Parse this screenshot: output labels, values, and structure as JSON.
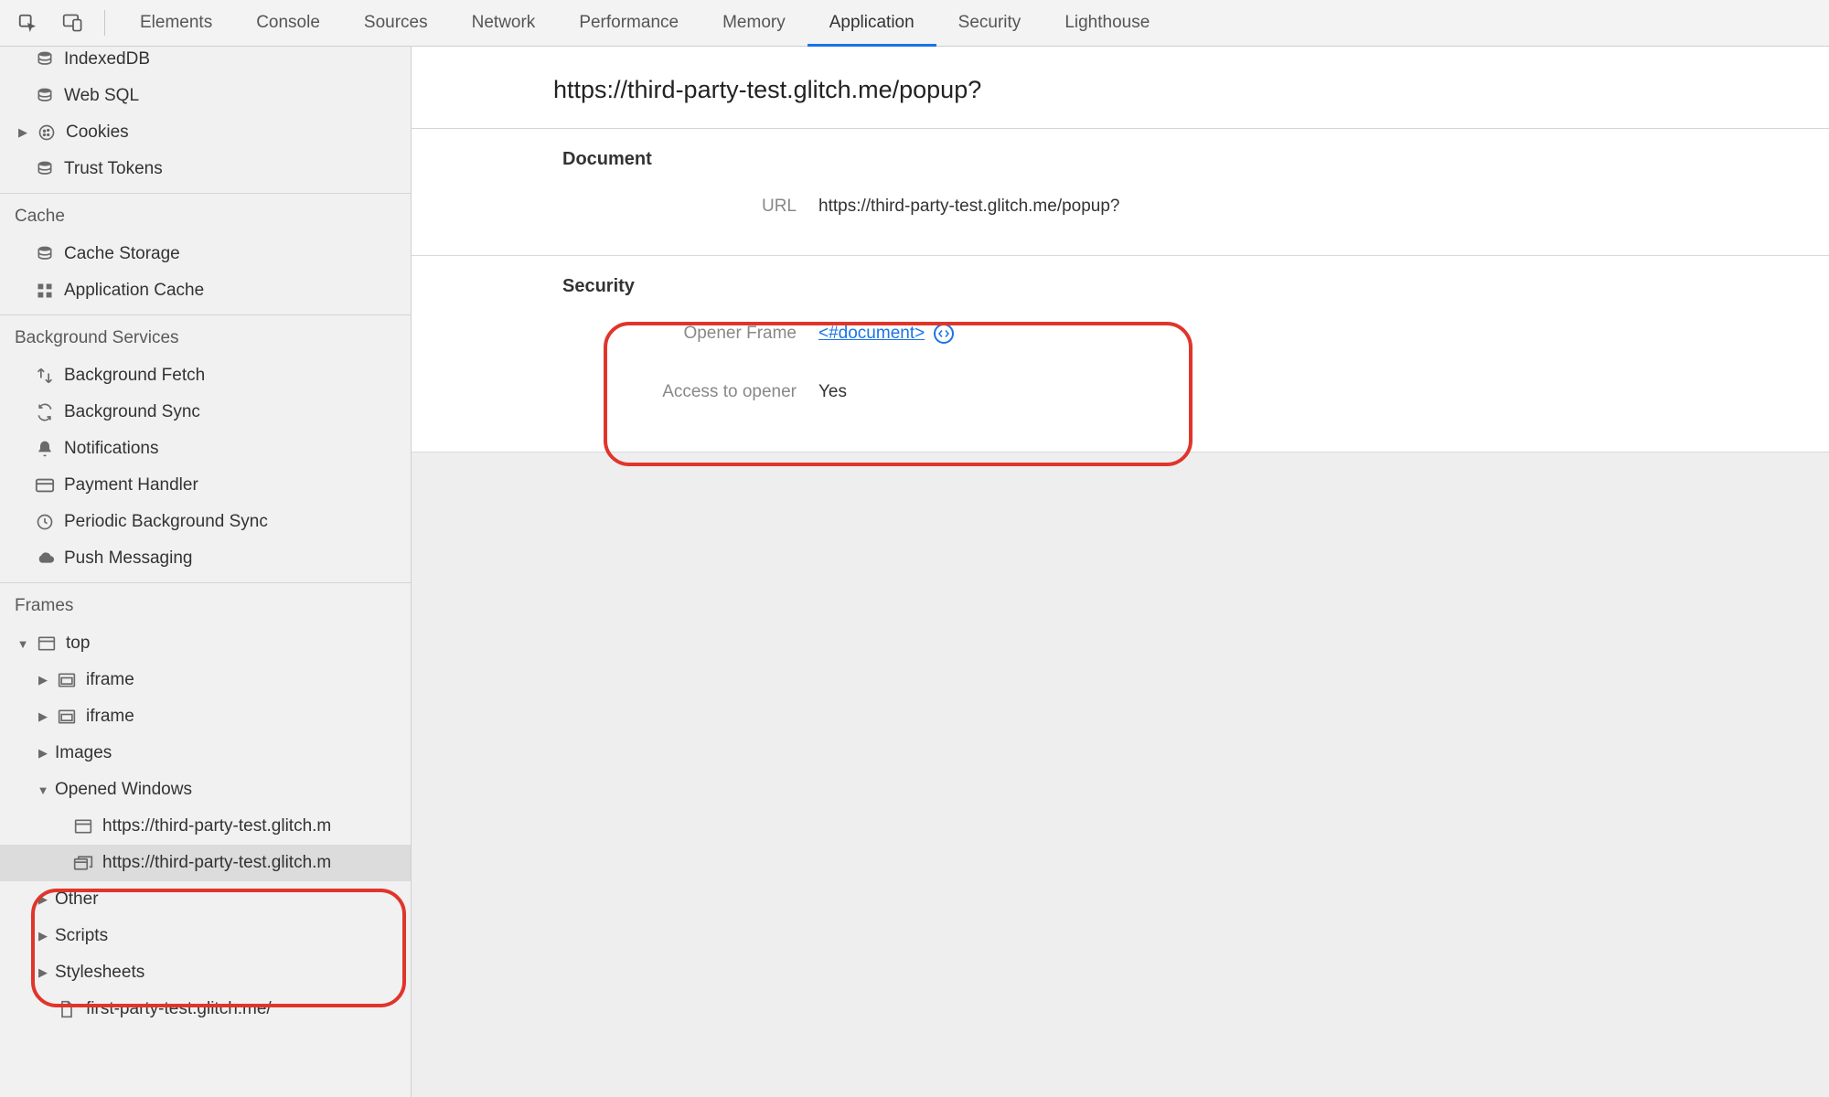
{
  "toolbar": {
    "tabs": [
      "Elements",
      "Console",
      "Sources",
      "Network",
      "Performance",
      "Memory",
      "Application",
      "Security",
      "Lighthouse"
    ],
    "activeTab": "Application"
  },
  "sidebar": {
    "storage": {
      "items": [
        "IndexedDB",
        "Web SQL",
        "Cookies",
        "Trust Tokens"
      ]
    },
    "cache": {
      "title": "Cache",
      "items": [
        "Cache Storage",
        "Application Cache"
      ]
    },
    "backgroundServices": {
      "title": "Background Services",
      "items": [
        "Background Fetch",
        "Background Sync",
        "Notifications",
        "Payment Handler",
        "Periodic Background Sync",
        "Push Messaging"
      ]
    },
    "frames": {
      "title": "Frames",
      "top": "top",
      "children": {
        "iframe1": "iframe",
        "iframe2": "iframe",
        "images": "Images",
        "openedWindows": {
          "label": "Opened Windows",
          "windows": [
            "https://third-party-test.glitch.m",
            "https://third-party-test.glitch.m"
          ]
        },
        "other": "Other",
        "scripts": "Scripts",
        "stylesheets": "Stylesheets",
        "firstParty": "first-party-test.glitch.me/"
      }
    }
  },
  "main": {
    "title": "https://third-party-test.glitch.me/popup?",
    "document": {
      "heading": "Document",
      "urlLabel": "URL",
      "urlValue": "https://third-party-test.glitch.me/popup?"
    },
    "security": {
      "heading": "Security",
      "openerFrameLabel": "Opener Frame",
      "openerFrameValue": "<#document>",
      "accessLabel": "Access to opener",
      "accessValue": "Yes"
    }
  }
}
